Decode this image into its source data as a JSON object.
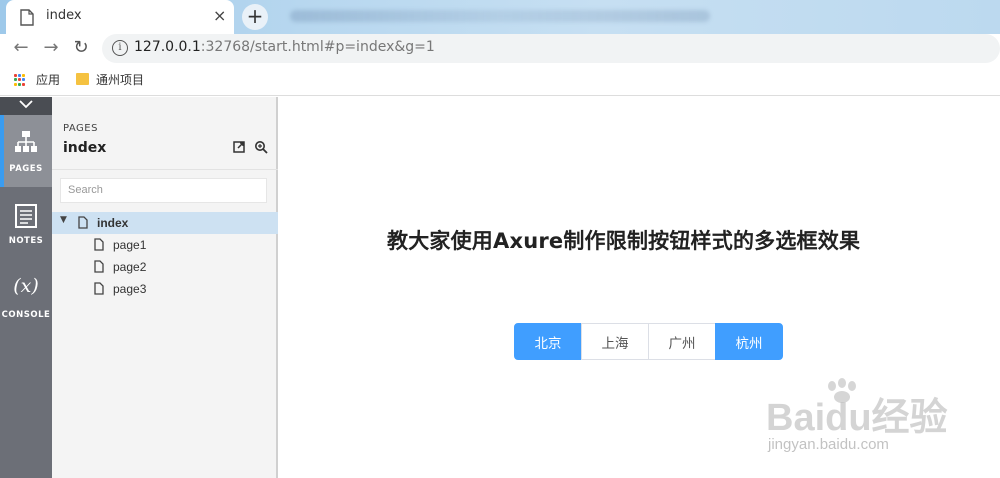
{
  "browser": {
    "tab_title": "index",
    "tab_close": "×",
    "new_tab": "+",
    "url_host": "127.0.0.1",
    "url_rest": ":32768/start.html#p=index&g=1",
    "bookmarks": [
      {
        "label": "应用",
        "icon": "apps-grid-icon"
      },
      {
        "label": "通州项目",
        "icon": "folder-icon"
      }
    ]
  },
  "rail": {
    "items": [
      {
        "label": "PAGES",
        "icon": "sitemap-icon",
        "active": true
      },
      {
        "label": "NOTES",
        "icon": "notes-icon",
        "active": false
      },
      {
        "label": "CONSOLE",
        "icon": "variable-icon",
        "glyph": "(x)",
        "active": false
      }
    ]
  },
  "pages_panel": {
    "heading": "PAGES",
    "current_page": "index",
    "search_placeholder": "Search",
    "tree": [
      {
        "label": "index",
        "selected": true
      },
      {
        "label": "page1",
        "selected": false
      },
      {
        "label": "page2",
        "selected": false
      },
      {
        "label": "page3",
        "selected": false
      }
    ]
  },
  "content": {
    "headline": "教大家使用Axure制作限制按钮样式的多选框效果",
    "options": [
      {
        "label": "北京",
        "selected": true
      },
      {
        "label": "上海",
        "selected": false
      },
      {
        "label": "广州",
        "selected": false
      },
      {
        "label": "杭州",
        "selected": true
      }
    ],
    "selected_color": "#409eff"
  },
  "watermark": {
    "brand": "Baidu经验",
    "sub": "jingyan.baidu.com"
  }
}
